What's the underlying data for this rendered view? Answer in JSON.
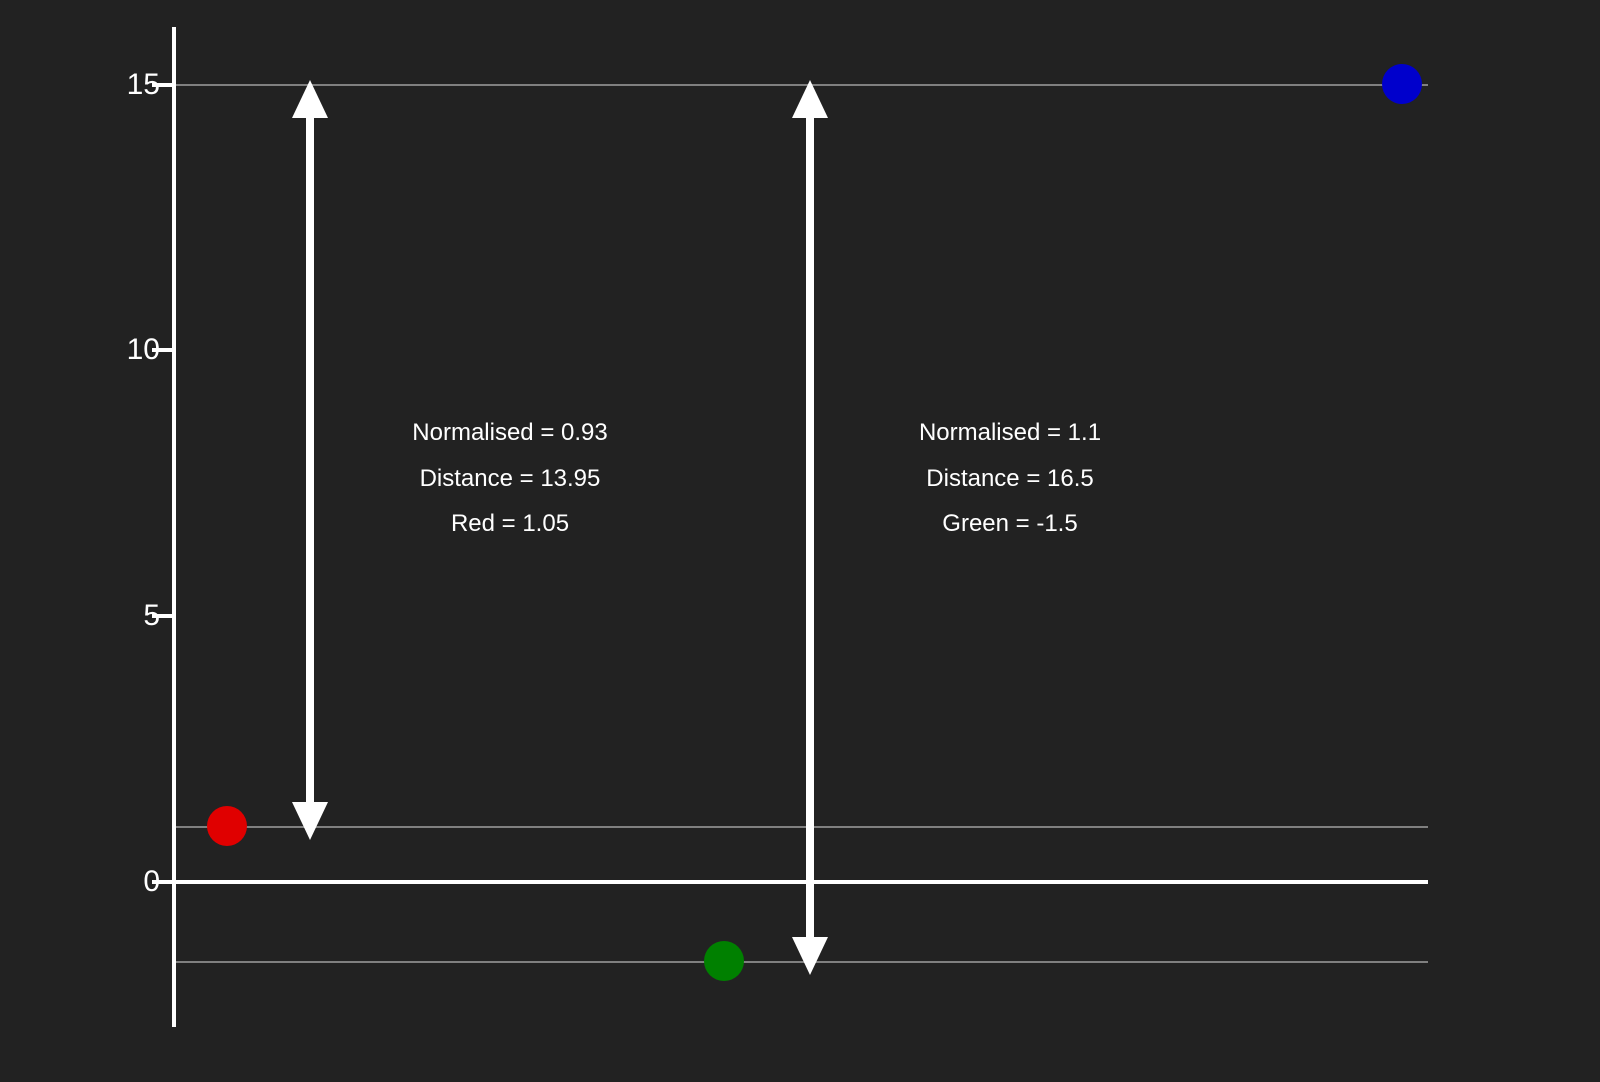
{
  "chart_data": {
    "type": "scatter",
    "y_ticks": [
      0,
      5,
      10,
      15
    ],
    "ylim": [
      -2.5,
      15.5
    ],
    "points": [
      {
        "name": "Red",
        "y": 1.05,
        "color": "#e00000"
      },
      {
        "name": "Green",
        "y": -1.5,
        "color": "#008000"
      },
      {
        "name": "Blue",
        "y": 15,
        "color": "#0000cc"
      }
    ],
    "annotations": [
      {
        "target": "Red",
        "normalised_label": "Normalised = 0.93",
        "distance_label": "Distance = 13.95",
        "value_label": "Red = 1.05"
      },
      {
        "target": "Green",
        "normalised_label": "Normalised = 1.1",
        "distance_label": "Distance = 16.5",
        "value_label": "Green = -1.5"
      }
    ]
  }
}
